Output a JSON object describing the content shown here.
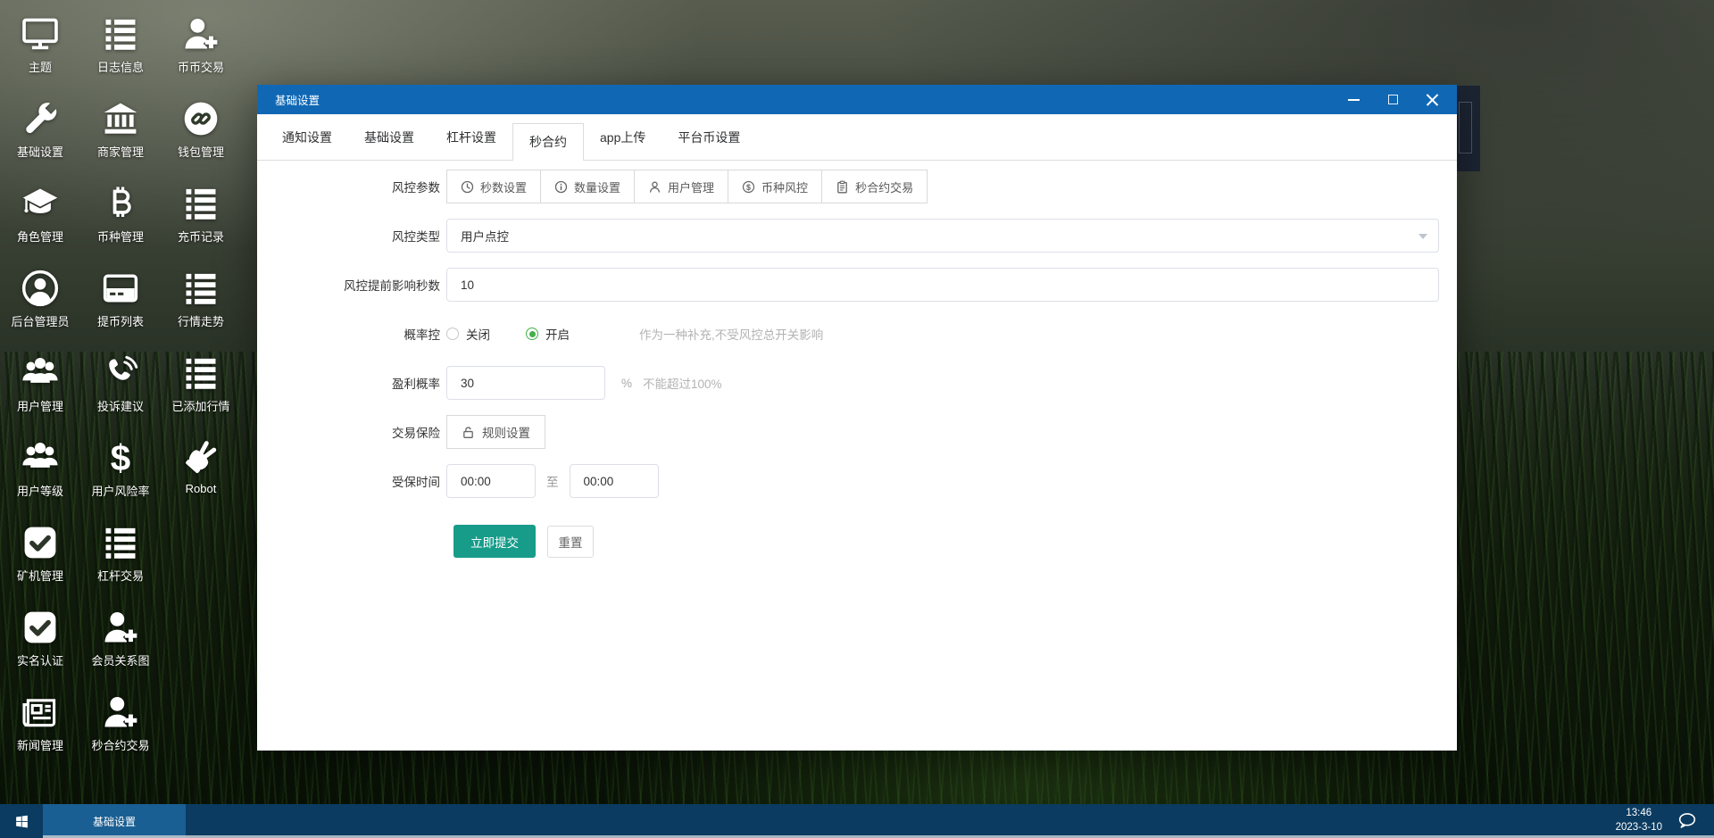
{
  "desktop": {
    "icons": [
      {
        "name": "theme",
        "label": "主题",
        "icon": "monitor-icon"
      },
      {
        "name": "log-info",
        "label": "日志信息",
        "icon": "list-icon"
      },
      {
        "name": "coin-trade",
        "label": "币币交易",
        "icon": "user-plus-icon"
      },
      {
        "name": "basic-settings",
        "label": "基础设置",
        "icon": "wrench-icon"
      },
      {
        "name": "merchant-mgmt",
        "label": "商家管理",
        "icon": "bank-icon"
      },
      {
        "name": "wallet-mgmt",
        "label": "钱包管理",
        "icon": "wallet-link-icon"
      },
      {
        "name": "role-mgmt",
        "label": "角色管理",
        "icon": "graduation-cap-icon"
      },
      {
        "name": "coin-mgmt",
        "label": "币种管理",
        "icon": "bitcoin-icon"
      },
      {
        "name": "deposit-records",
        "label": "充币记录",
        "icon": "list-icon"
      },
      {
        "name": "admin-users",
        "label": "后台管理员",
        "icon": "user-circle-icon"
      },
      {
        "name": "withdraw-list",
        "label": "提币列表",
        "icon": "credit-card-icon"
      },
      {
        "name": "market-trend",
        "label": "行情走势",
        "icon": "list-icon"
      },
      {
        "name": "user-mgmt",
        "label": "用户管理",
        "icon": "users-icon"
      },
      {
        "name": "feedback",
        "label": "投诉建议",
        "icon": "phone-icon"
      },
      {
        "name": "added-markets",
        "label": "已添加行情",
        "icon": "list-icon"
      },
      {
        "name": "user-level",
        "label": "用户等级",
        "icon": "users-icon"
      },
      {
        "name": "user-risk-rate",
        "label": "用户风险率",
        "icon": "dollar-icon"
      },
      {
        "name": "robot",
        "label": "Robot",
        "icon": "hand-peace-icon"
      },
      {
        "name": "miner-mgmt",
        "label": "矿机管理",
        "icon": "check-square-icon"
      },
      {
        "name": "leverage-trade",
        "label": "杠杆交易",
        "icon": "list-icon"
      },
      {
        "name": "real-name-auth",
        "label": "实名认证",
        "icon": "check-square-icon"
      },
      {
        "name": "member-graph",
        "label": "会员关系图",
        "icon": "user-plus-icon"
      },
      {
        "name": "news-mgmt",
        "label": "新闻管理",
        "icon": "newspaper-icon"
      },
      {
        "name": "seconds-contract",
        "label": "秒合约交易",
        "icon": "user-plus-icon"
      }
    ]
  },
  "modal": {
    "title": "基础设置",
    "window_controls": [
      "minimize",
      "maximize",
      "close"
    ],
    "tabs": [
      {
        "label": "通知设置",
        "active": false
      },
      {
        "label": "基础设置",
        "active": false
      },
      {
        "label": "杠杆设置",
        "active": false
      },
      {
        "label": "秒合约",
        "active": true
      },
      {
        "label": "app上传",
        "active": false
      },
      {
        "label": "平台币设置",
        "active": false
      }
    ],
    "form": {
      "risk_params": {
        "label": "风控参数",
        "buttons": [
          {
            "label": "秒数设置",
            "icon": "clock-icon"
          },
          {
            "label": "数量设置",
            "icon": "info-circle-icon"
          },
          {
            "label": "用户管理",
            "icon": "person-icon"
          },
          {
            "label": "币种风控",
            "icon": "dollar-circle-icon"
          },
          {
            "label": "秒合约交易",
            "icon": "clipboard-icon"
          }
        ]
      },
      "risk_type": {
        "label": "风控类型",
        "value": "用户点控"
      },
      "advance_seconds": {
        "label": "风控提前影响秒数",
        "value": "10"
      },
      "probability": {
        "label": "概率控",
        "off_label": "关闭",
        "on_label": "开启",
        "selected": "开启",
        "hint": "作为一种补充,不受风控总开关影响"
      },
      "profit": {
        "label": "盈利概率",
        "value": "30",
        "unit": "%",
        "hint": "不能超过100%"
      },
      "insurance": {
        "label": "交易保险",
        "button_label": "规则设置",
        "button_icon": "lock-icon"
      },
      "insured_time": {
        "label": "受保时间",
        "from": "00:00",
        "separator": "至",
        "to": "00:00"
      },
      "submit_label": "立即提交",
      "reset_label": "重置"
    }
  },
  "taskbar": {
    "start_icon": "windows-start-icon",
    "active_task": "基础设置",
    "time": "13:46",
    "date": "2023-3-10",
    "tray_icon": "chat-bubble-icon"
  },
  "colors": {
    "titlebar_blue": "#1068b5",
    "submit_teal": "#179c8a",
    "radio_green": "#43b04a",
    "taskbar_navy": "#0b3b60",
    "task_active_blue": "#1a5f93"
  }
}
